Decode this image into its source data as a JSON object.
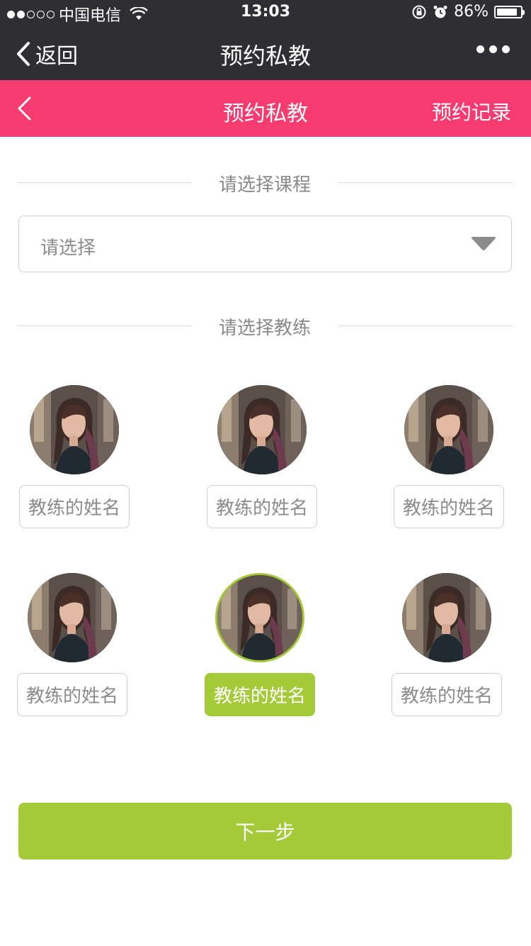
{
  "status_bar": {
    "carrier": "中国电信",
    "time": "13:03",
    "battery": "86%",
    "battery_level": 0.86,
    "icons": [
      "signal-icon",
      "wifi-icon",
      "lock-rotation-icon",
      "alarm-icon",
      "battery-icon"
    ]
  },
  "wx_nav": {
    "back_label": "返回",
    "title": "预约私教",
    "more_icon": "more-dots-icon"
  },
  "header": {
    "title": "预约私教",
    "records_label": "预约记录",
    "back_icon": "chevron-left-icon",
    "background": "#f63b70"
  },
  "course_section": {
    "label": "请选择课程",
    "select_placeholder": "请选择"
  },
  "coach_section": {
    "label": "请选择教练",
    "coaches": [
      {
        "name": "教练的姓名",
        "selected": false
      },
      {
        "name": "教练的姓名",
        "selected": false
      },
      {
        "name": "教练的姓名",
        "selected": false
      },
      {
        "name": "教练的姓名",
        "selected": false
      },
      {
        "name": "教练的姓名",
        "selected": true
      },
      {
        "name": "教练的姓名",
        "selected": false
      }
    ]
  },
  "next_button": {
    "label": "下一步"
  },
  "colors": {
    "accent_green": "#a4ca38",
    "header_pink": "#f63b70",
    "dark_bar": "#2f2f33"
  }
}
